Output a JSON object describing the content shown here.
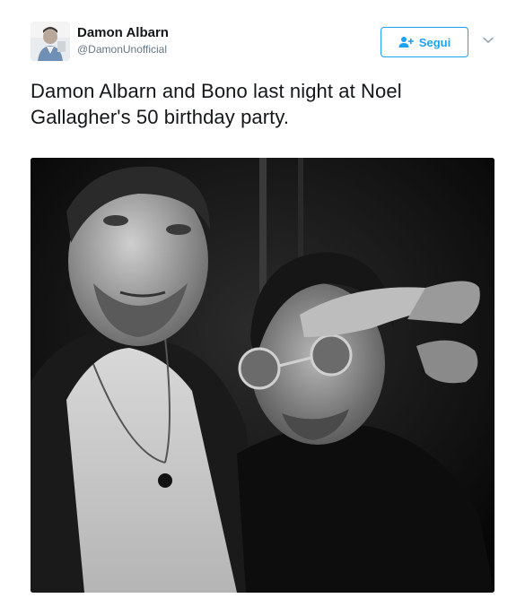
{
  "author": {
    "name": "Damon Albarn",
    "handle": "@DamonUnofficial"
  },
  "follow_button": {
    "label": "Segui",
    "icon": "add-user-icon"
  },
  "more_menu": {
    "icon": "chevron-down-icon"
  },
  "tweet": {
    "text": "Damon Albarn and Bono last night at Noel Gallagher's 50 birthday party."
  },
  "colors": {
    "accent": "#1da1f2",
    "text": "#14171a",
    "secondary": "#657786"
  }
}
